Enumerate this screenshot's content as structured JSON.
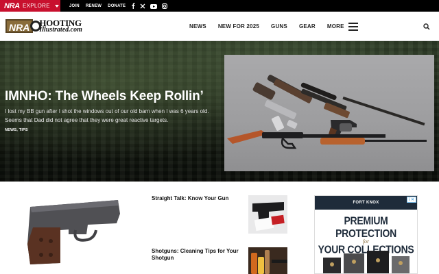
{
  "topbar": {
    "brand": "NRA",
    "explore_label": "EXPLORE",
    "links": [
      "JOIN",
      "RENEW",
      "DONATE"
    ],
    "social_icons": [
      "facebook-icon",
      "x-icon",
      "youtube-icon",
      "instagram-icon"
    ]
  },
  "header": {
    "logo_nra": "NRA",
    "logo_word1": "HOOTING",
    "logo_word2": "Illustrated.com",
    "nav": [
      "NEWS",
      "NEW FOR 2025",
      "GUNS",
      "GEAR",
      "MORE"
    ],
    "search_icon": "search-icon"
  },
  "hero": {
    "title": "IMNHO: The Wheels Keep Rollin’",
    "excerpt": "I lost my BB gun after I shot the windows out of our old barn when I was 6 years old. Seems that Dad did not agree that they were great reactive targets.",
    "tags": "NEWS, TIPS"
  },
  "stories": [
    {
      "title": "Straight Talk: Know Your Gun"
    },
    {
      "title": "Shotguns: Cleaning Tips for Your Shotgun"
    }
  ],
  "ad": {
    "brand": "FORT KNOX",
    "headline1": "PREMIUM PROTECTION",
    "connector": "for",
    "headline2": "YOUR COLLECTIONS",
    "badge": "i ✕"
  },
  "colors": {
    "nra_red": "#c8102e",
    "topbar_black": "#000000",
    "ad_navy": "#1e2b3a",
    "ad_gold": "#8a6d3b"
  }
}
